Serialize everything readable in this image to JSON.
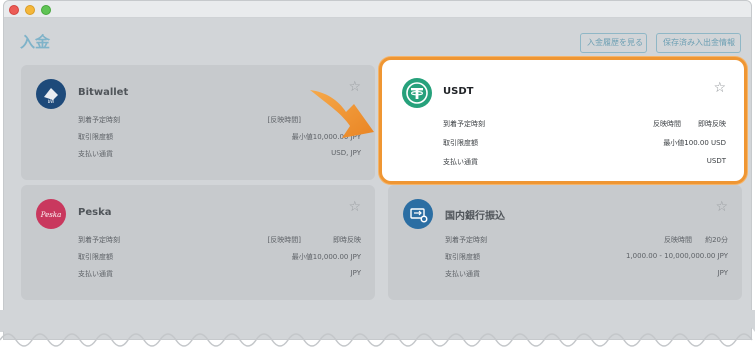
{
  "page": {
    "title": "入金"
  },
  "header_buttons": {
    "history": "入金履歴を見る",
    "saved": "保存済み入出金情報"
  },
  "labels": {
    "arrival": "到着予定時刻",
    "limit": "取引限度額",
    "currency": "支払い通貨"
  },
  "cards": [
    {
      "name": "Bitwallet",
      "arrival_tag": "[反映時間]",
      "arrival": "",
      "limit": "最小値10,000.00 JPY",
      "currency": "USD, JPY"
    },
    {
      "name": "USDT",
      "arrival_tag": "反映時間",
      "arrival": "即時反映",
      "limit": "最小値100.00 USD",
      "currency": "USDT"
    },
    {
      "name": "Peska",
      "logo_text": "Peska",
      "arrival_tag": "[反映時間]",
      "arrival": "即時反映",
      "limit": "最小値10,000.00 JPY",
      "currency": "JPY"
    },
    {
      "name": "国内銀行振込",
      "arrival_tag": "反映時間",
      "arrival": "約20分",
      "limit": "1,000.00 - 10,000,000.00 JPY",
      "currency": "JPY"
    }
  ],
  "colors": {
    "highlight_border": "#ef9633",
    "usdt_green": "#26a17b",
    "bitwallet_blue": "#1e4a7a",
    "peska_pink": "#c9385e",
    "bank_blue": "#2b6ea3"
  }
}
